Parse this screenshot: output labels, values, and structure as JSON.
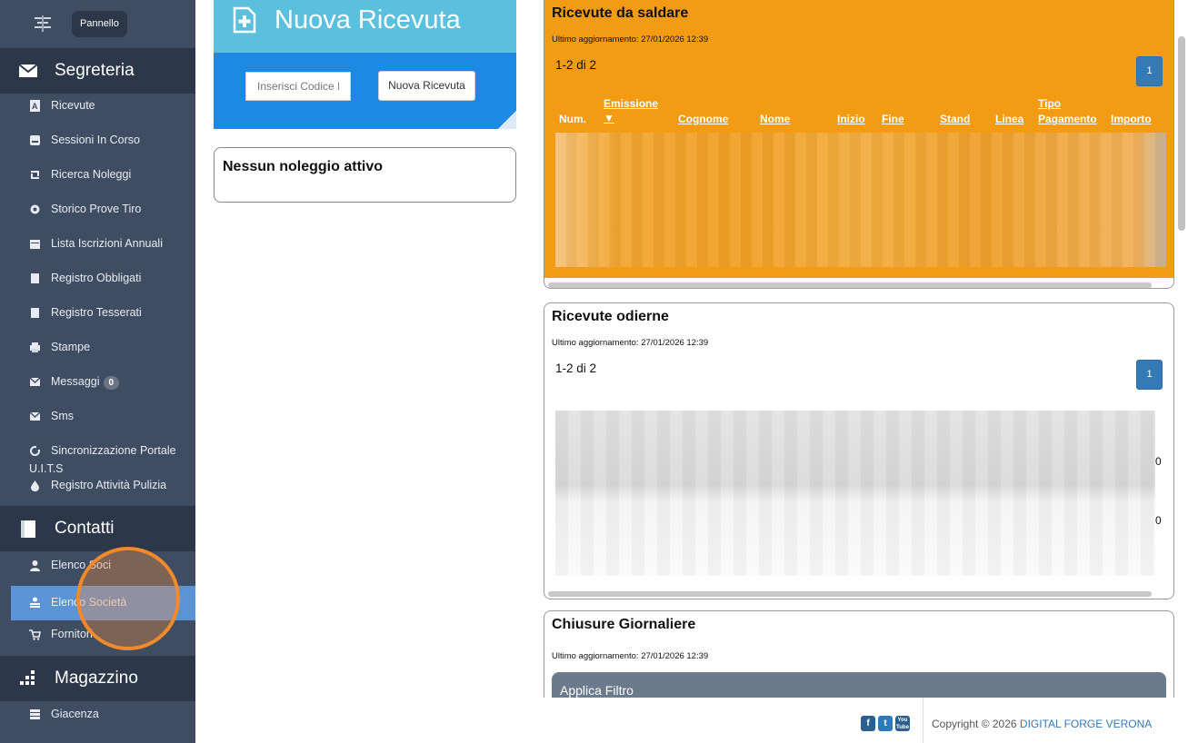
{
  "sidebar": {
    "top_button": "Pannello",
    "sections": [
      {
        "title": "Segreteria",
        "icon": "envelope-icon"
      },
      {
        "title": "Contatti",
        "icon": "book-icon"
      },
      {
        "title": "Magazzino",
        "icon": "grid-icon"
      }
    ],
    "segreteria_items": [
      {
        "label": "Ricevute",
        "icon": "receipt-icon"
      },
      {
        "label": "Sessioni In Corso",
        "icon": "inbox-icon"
      },
      {
        "label": "Ricerca Noleggi",
        "icon": "retweet-icon"
      },
      {
        "label": "Storico Prove Tiro",
        "icon": "gear-icon"
      },
      {
        "label": "Lista Iscrizioni Annuali",
        "icon": "calendar-icon"
      },
      {
        "label": "Registro Obbligati",
        "icon": "book-icon"
      },
      {
        "label": "Registro Tesserati",
        "icon": "book-icon"
      },
      {
        "label": "Stampe",
        "icon": "print-icon"
      },
      {
        "label": "Messaggi",
        "icon": "envelope-icon",
        "badge": "0"
      },
      {
        "label": "Sms",
        "icon": "envelope-icon"
      },
      {
        "label": "Sincronizzazione Portale",
        "label2": "U.I.T.S",
        "icon": "refresh-icon"
      },
      {
        "label": "Registro Attività Pulizia",
        "icon": "drop-icon"
      }
    ],
    "contatti_items": [
      {
        "label": "Elenco Soci",
        "icon": "user-icon"
      },
      {
        "label": "Elenco Società",
        "icon": "group-icon",
        "active": true
      },
      {
        "label": "Fornitori",
        "icon": "cart-icon"
      }
    ],
    "magazzino_items": [
      {
        "label": "Giacenza",
        "icon": "list-icon"
      }
    ]
  },
  "nuova_ricevuta": {
    "title": "Nuova Ricevuta",
    "input_placeholder": "Inserisci Codice I",
    "button": "Nuova Ricevuta"
  },
  "noleggio": {
    "text": "Nessun noleggio attivo"
  },
  "panels": {
    "saldare": {
      "title": "Ricevute da saldare",
      "updated": "Ultimo aggiornamento: 27/01/2026 12:39",
      "count": "1-2 di 2",
      "page": "1",
      "columns": [
        "Num.",
        "Emissione",
        "▼",
        "Cognome",
        "Nome",
        "Inizio",
        "Fine",
        "Stand",
        "Linea",
        "Tipo",
        "Pagamento",
        "Importo"
      ]
    },
    "odierne": {
      "title": "Ricevute odierne",
      "updated": "Ultimo aggiornamento: 27/01/2026 12:39",
      "count": "1-2 di 2",
      "page": "1",
      "partial_values": [
        "0",
        "0"
      ]
    },
    "chiusure": {
      "title": "Chiusure Giornaliere",
      "updated": "Ultimo aggiornamento: 27/01/2026 12:39",
      "filter_button": "Applica Filtro"
    }
  },
  "footer": {
    "copyright": "Copyright © 2026",
    "brand": "DIGITAL FORGE VERONA",
    "social": [
      "f",
      "t",
      "You Tube"
    ]
  },
  "colors": {
    "sidebar_bg": "#3f4d63",
    "section_bg": "#2c374a",
    "active_item": "#5b93d7",
    "orange_panel": "#f29b13",
    "header_cyan": "#5bc0de",
    "primary_blue": "#1e88e5",
    "page_button": "#337ab7"
  }
}
